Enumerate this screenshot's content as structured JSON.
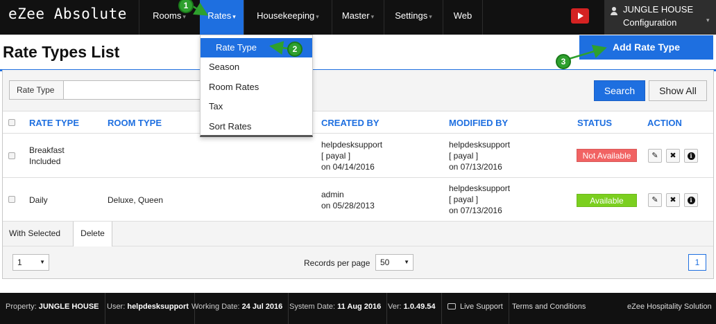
{
  "app": {
    "brand": "eZee Absolute"
  },
  "nav": [
    {
      "label": "Rooms",
      "has_caret": true
    },
    {
      "label": "Rates",
      "has_caret": true,
      "active": true
    },
    {
      "label": "Housekeeping",
      "has_caret": true
    },
    {
      "label": "Master",
      "has_caret": true
    },
    {
      "label": "Settings",
      "has_caret": true
    },
    {
      "label": "Web",
      "has_caret": false
    }
  ],
  "user": {
    "name": "JUNGLE HOUSE",
    "sub": "Configuration"
  },
  "dropdown": [
    "Rate Type",
    "Season",
    "Room Rates",
    "Tax",
    "Sort Rates"
  ],
  "page": {
    "title": "Rate Types List",
    "add_button": "Add Rate Type"
  },
  "filter": {
    "label": "Rate Type",
    "value": "",
    "placeholder": "",
    "search": "Search",
    "show_all": "Show All"
  },
  "table": {
    "headers": [
      "RATE TYPE",
      "ROOM TYPE",
      "CREATED BY",
      "MODIFIED BY",
      "STATUS",
      "ACTION"
    ],
    "rows": [
      {
        "rate_type": [
          "Breakfast",
          "Included"
        ],
        "room_type": "",
        "created_by": [
          "helpdesksupport",
          "[ payal ]",
          "on 04/14/2016"
        ],
        "modified_by": [
          "helpdesksupport",
          "[ payal ]",
          "on 07/13/2016"
        ],
        "status": "Not Available"
      },
      {
        "rate_type": [
          "Daily"
        ],
        "room_type": "Deluxe, Queen",
        "created_by": [
          "admin",
          "on 05/28/2013"
        ],
        "modified_by": [
          "helpdesksupport",
          "[ payal ]",
          "on 07/13/2016"
        ],
        "status": "Available"
      }
    ]
  },
  "bulk": {
    "label": "With Selected",
    "delete": "Delete"
  },
  "pager": {
    "page_select": "1",
    "records_label": "Records per page",
    "records_value": "50",
    "current_page": "1"
  },
  "footer": {
    "property_label": "Property:",
    "property": "JUNGLE HOUSE",
    "user_label": "User:",
    "user": "helpdesksupport",
    "working_label": "Working Date:",
    "working": "24 Jul 2016",
    "system_label": "System Date:",
    "system": "11 Aug 2016",
    "ver_label": "Ver:",
    "ver": "1.0.49.54",
    "live_support": "Live Support",
    "terms": "Terms and Conditions",
    "company": "eZee Hospitality Solution"
  },
  "markers": [
    "1",
    "2",
    "3"
  ],
  "colors": {
    "accent": "#1e6fe0",
    "nav_bg": "#111111",
    "status_na": "#f16363",
    "status_av": "#7bcf1f",
    "marker": "#2ea02e"
  }
}
